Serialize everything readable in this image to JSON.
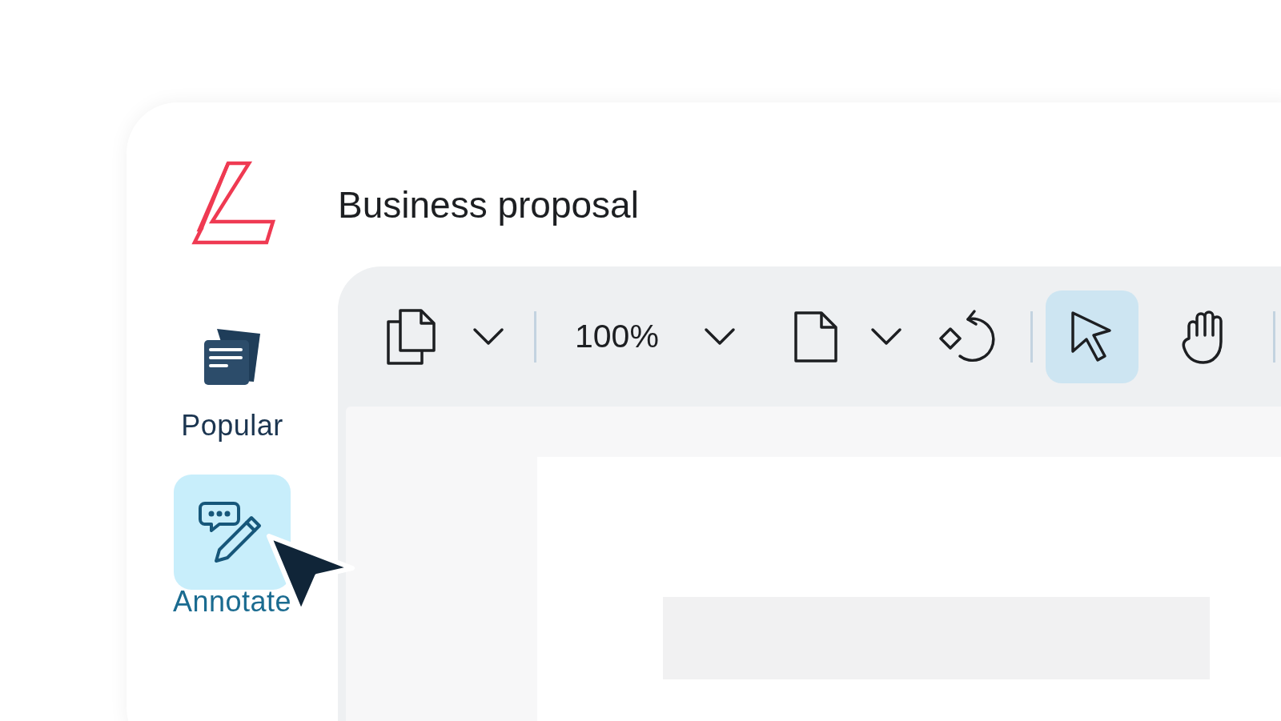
{
  "app": {
    "title": "Business proposal"
  },
  "sidebar": {
    "items": [
      {
        "label": "Popular",
        "selected": false
      },
      {
        "label": "Annotate",
        "selected": true
      }
    ]
  },
  "toolbar": {
    "zoom": "100%",
    "tools": [
      {
        "selected": true
      },
      {
        "selected": false
      }
    ]
  }
}
